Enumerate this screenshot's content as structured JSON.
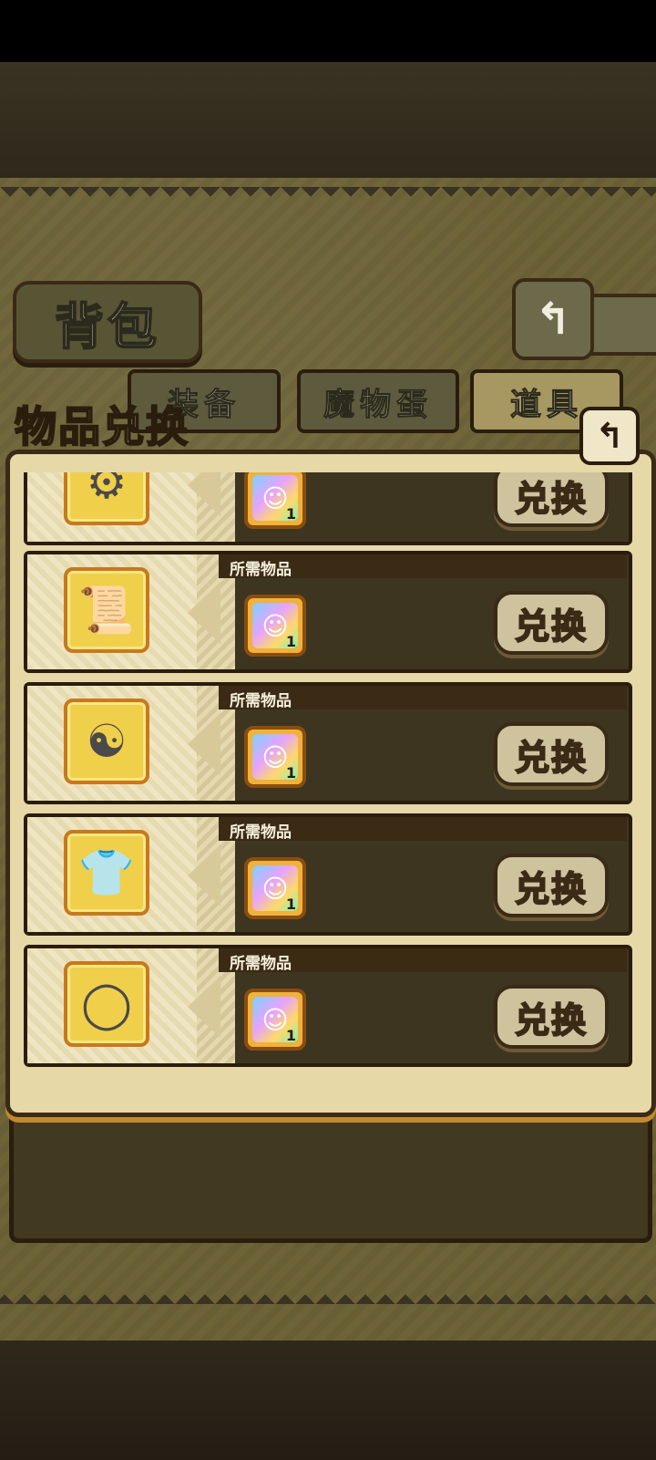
{
  "screen": {
    "title": "背包",
    "tabs": [
      {
        "label": "装备"
      },
      {
        "label": "魔物蛋"
      },
      {
        "label": "道具"
      }
    ]
  },
  "modal": {
    "title": "物品兑换",
    "rows": [
      {
        "reward_icon": "gears-icon",
        "required_label": "",
        "required_icon": "rainbow-box-icon",
        "required_qty": "1",
        "button": "兑换"
      },
      {
        "reward_icon": "scroll-icon",
        "required_label": "所需物品",
        "required_icon": "rainbow-box-icon",
        "required_qty": "1",
        "button": "兑换"
      },
      {
        "reward_icon": "yin-yang-amulet-icon",
        "required_label": "所需物品",
        "required_icon": "rainbow-box-icon",
        "required_qty": "1",
        "button": "兑换"
      },
      {
        "reward_icon": "cloth-armor-icon",
        "required_label": "所需物品",
        "required_icon": "rainbow-box-icon",
        "required_qty": "1",
        "button": "兑换"
      },
      {
        "reward_icon": "feather-ring-icon",
        "required_label": "所需物品",
        "required_icon": "rainbow-box-icon",
        "required_qty": "1",
        "button": "兑换"
      }
    ]
  }
}
